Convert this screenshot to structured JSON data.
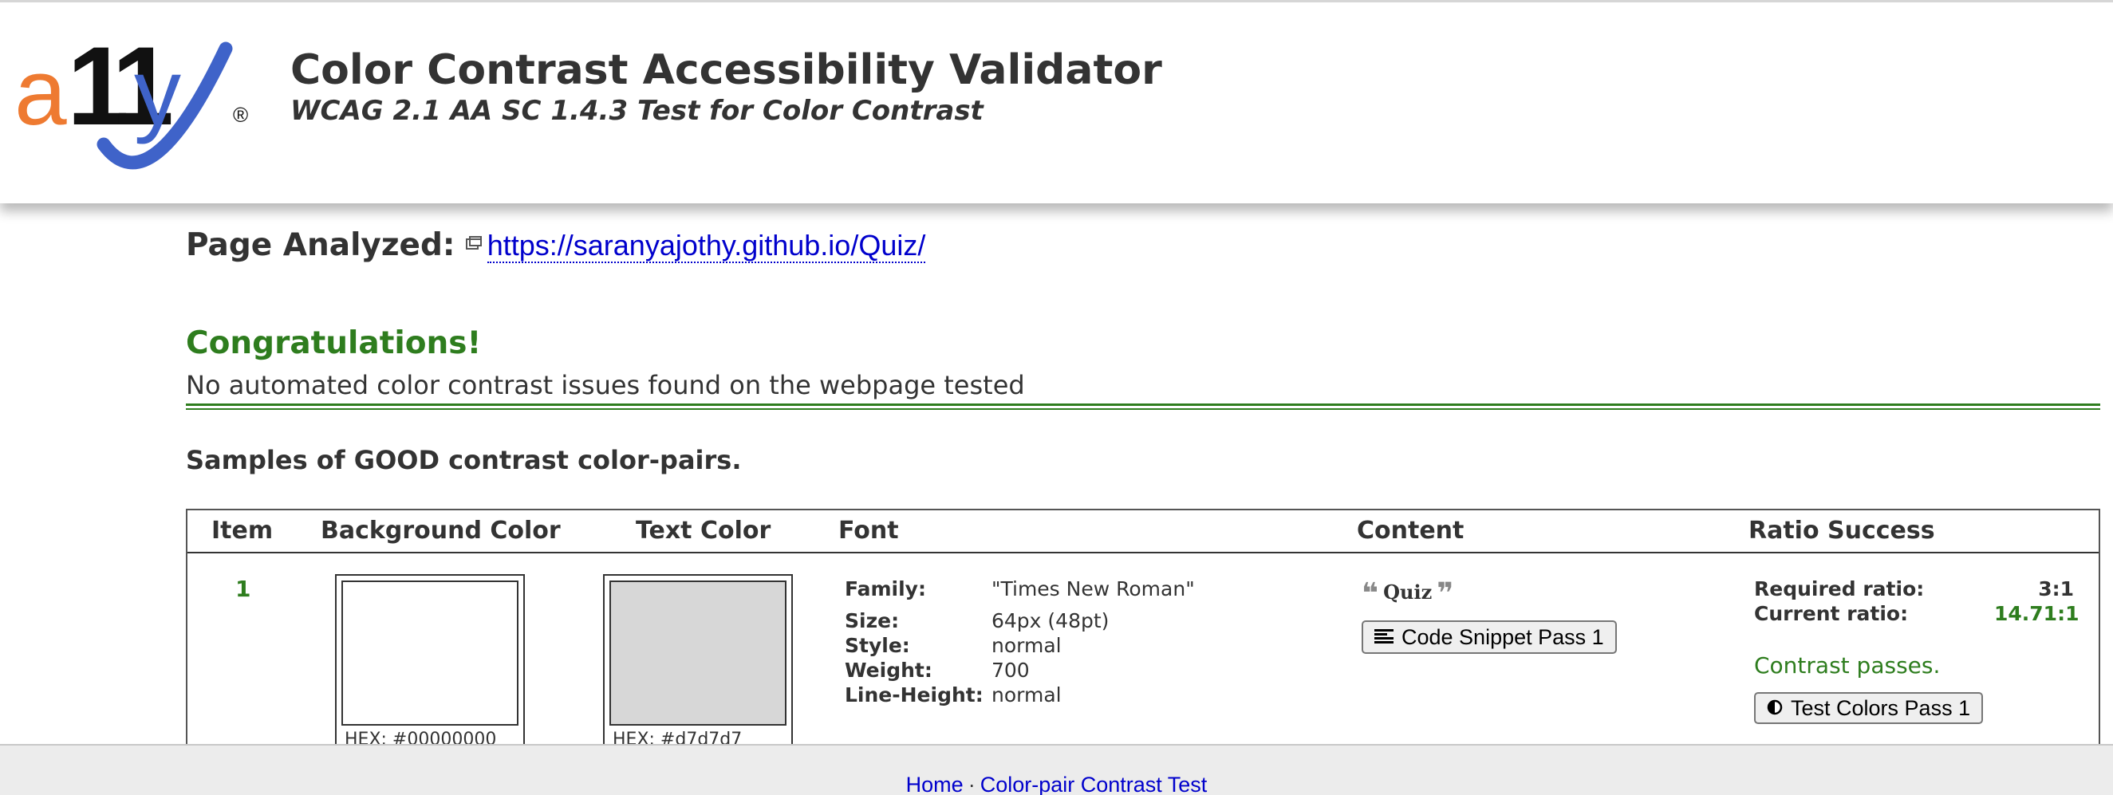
{
  "header": {
    "logo_text": "a11y",
    "logo_mark": "®",
    "title": "Color Contrast Accessibility Validator",
    "subtitle": "WCAG 2.1 AA SC 1.4.3 Test for Color Contrast"
  },
  "page_analyzed": {
    "label": "Page Analyzed:",
    "url": "https://saranyajothy.github.io/Quiz/",
    "icon": "external-window-icon"
  },
  "result": {
    "heading": "Congratulations!",
    "message": "No automated color contrast issues found on the webpage tested"
  },
  "samples_heading": "Samples of GOOD contrast color-pairs.",
  "table": {
    "headers": {
      "item": "Item",
      "background_color": "Background Color",
      "text_color": "Text Color",
      "font": "Font",
      "content": "Content",
      "ratio_success": "Ratio Success"
    },
    "rows": [
      {
        "item": "1",
        "background": {
          "hex_label": "HEX: #00000000",
          "color": "#ffffff"
        },
        "text_color": {
          "hex_label": "HEX: #d7d7d7",
          "color": "#d7d7d7"
        },
        "font": {
          "family_label": "Family:",
          "family": "\"Times New Roman\"",
          "size_label": "Size:",
          "size": "64px (48pt)",
          "style_label": "Style:",
          "style": "normal",
          "weight_label": "Weight:",
          "weight": "700",
          "line_height_label": "Line-Height:",
          "line_height": "normal"
        },
        "content": {
          "open_quote": "❝",
          "text": "Quiz",
          "close_quote": "❞",
          "code_button": "Code Snippet Pass 1"
        },
        "ratio": {
          "required_label": "Required ratio:",
          "required": "3:1",
          "current_label": "Current ratio:",
          "current": "14.71:1",
          "status": "Contrast passes.",
          "test_button": "Test Colors Pass 1"
        }
      }
    ]
  },
  "footer": {
    "home": "Home",
    "separator": "·",
    "test_link": "Color-pair Contrast Test"
  },
  "colors": {
    "success_green": "#2e7d1e",
    "link_blue": "#0000cc",
    "logo_orange": "#ee7a31",
    "logo_blue": "#3f63c9",
    "text_dark": "#333333"
  }
}
